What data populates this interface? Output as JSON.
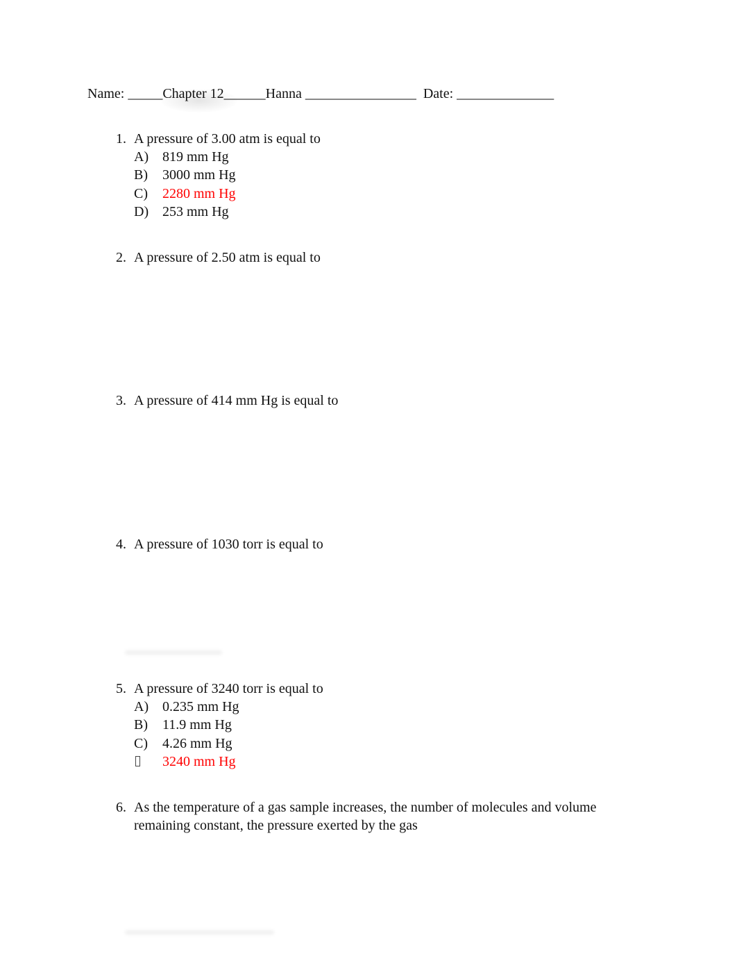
{
  "header": {
    "name_label": "Name:",
    "name_value": " _____Chapter 12______Hanna ________________",
    "date_label": "  Date:",
    "date_value": " ______________"
  },
  "questions": [
    {
      "number": "1.",
      "text": "A pressure of 3.00 atm is equal to",
      "choices": [
        {
          "letter": "A)",
          "text": "819 mm Hg",
          "answer": false
        },
        {
          "letter": "B)",
          "text": "3000 mm Hg",
          "answer": false
        },
        {
          "letter": "C)",
          "text": "2280 mm Hg",
          "answer": true
        },
        {
          "letter": "D)",
          "text": "253 mm Hg",
          "answer": false
        }
      ]
    },
    {
      "number": "2.",
      "text": "A pressure of 2.50 atm is equal to",
      "choices": []
    },
    {
      "number": "3.",
      "text": "A pressure of 414 mm Hg is equal to",
      "choices": []
    },
    {
      "number": "4.",
      "text": "A pressure of 1030 torr is equal to",
      "choices": []
    },
    {
      "number": "5.",
      "text": "A pressure of 3240 torr is equal to",
      "choices": [
        {
          "letter": "A)",
          "text": "0.235 mm Hg",
          "answer": false
        },
        {
          "letter": "B)",
          "text": "11.9 mm Hg",
          "answer": false
        },
        {
          "letter": "C)",
          "text": "4.26 mm Hg",
          "answer": false
        },
        {
          "letter": "missing-glyph",
          "text": "3240 mm Hg",
          "answer": true
        }
      ]
    },
    {
      "number": "6.",
      "text": "As the temperature of a gas sample increases, the number of molecules and volume remaining constant, the pressure exerted by the gas",
      "choices": []
    }
  ],
  "colors": {
    "answer": "#ff0000",
    "text": "#111111"
  }
}
